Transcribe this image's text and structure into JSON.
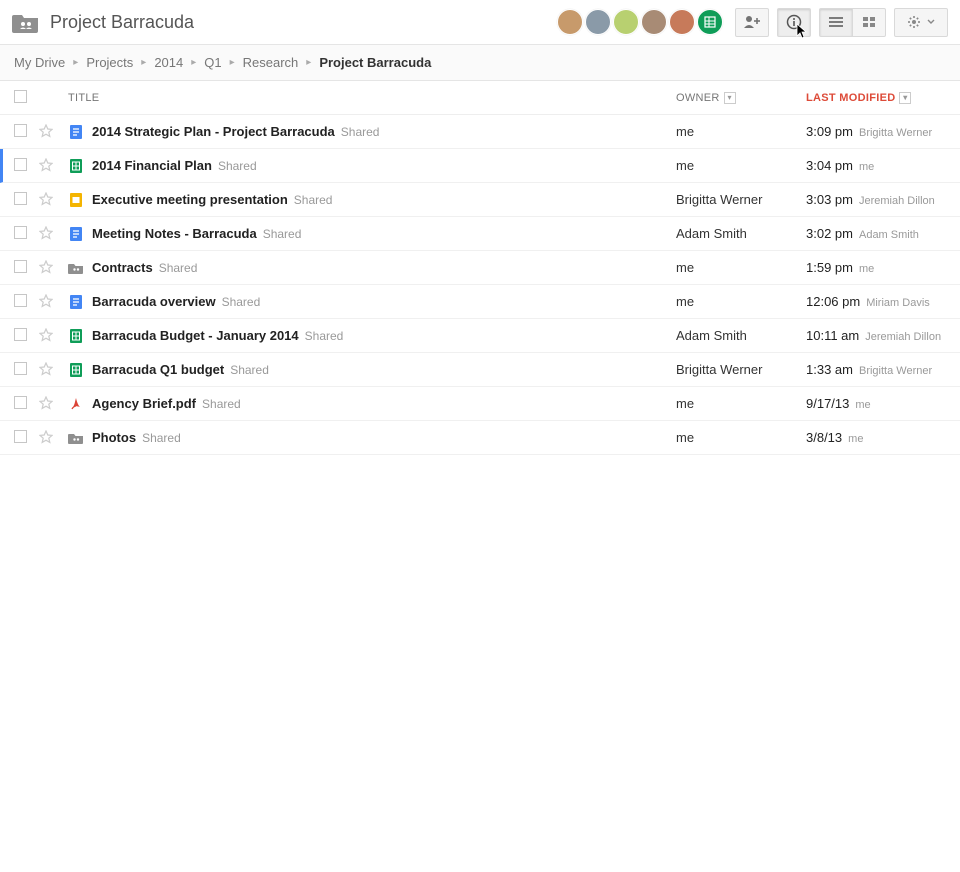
{
  "header": {
    "title": "Project Barracuda"
  },
  "breadcrumbs": [
    {
      "label": "My Drive",
      "current": false
    },
    {
      "label": "Projects",
      "current": false
    },
    {
      "label": "2014",
      "current": false
    },
    {
      "label": "Q1",
      "current": false
    },
    {
      "label": "Research",
      "current": false
    },
    {
      "label": "Project Barracuda",
      "current": true
    }
  ],
  "columns": {
    "title": "TITLE",
    "owner": "OWNER",
    "modified": "LAST MODIFIED"
  },
  "shared_label": "Shared",
  "avatars": [
    "#c79a6b",
    "#8a9aa8",
    "#b8d070",
    "#a88b75",
    "#c77a5a",
    "#0f9d58"
  ],
  "files": [
    {
      "icon": "doc",
      "title": "2014 Strategic Plan - Project Barracuda",
      "shared": true,
      "owner": "me",
      "time": "3:09 pm",
      "by": "Brigitta Werner",
      "selected": false
    },
    {
      "icon": "sheet",
      "title": "2014 Financial Plan",
      "shared": true,
      "owner": "me",
      "time": "3:04 pm",
      "by": "me",
      "selected": true
    },
    {
      "icon": "slides",
      "title": "Executive meeting presentation",
      "shared": true,
      "owner": "Brigitta Werner",
      "time": "3:03 pm",
      "by": "Jeremiah Dillon",
      "selected": false
    },
    {
      "icon": "doc",
      "title": "Meeting Notes - Barracuda",
      "shared": true,
      "owner": "Adam Smith",
      "time": "3:02 pm",
      "by": "Adam Smith",
      "selected": false
    },
    {
      "icon": "folder",
      "title": "Contracts",
      "shared": true,
      "owner": "me",
      "time": "1:59 pm",
      "by": "me",
      "selected": false
    },
    {
      "icon": "doc",
      "title": "Barracuda overview",
      "shared": true,
      "owner": "me",
      "time": "12:06 pm",
      "by": "Miriam Davis",
      "selected": false
    },
    {
      "icon": "sheet",
      "title": "Barracuda Budget - January 2014",
      "shared": true,
      "owner": "Adam Smith",
      "time": "10:11 am",
      "by": "Jeremiah Dillon",
      "selected": false
    },
    {
      "icon": "sheet",
      "title": "Barracuda Q1 budget",
      "shared": true,
      "owner": "Brigitta Werner",
      "time": "1:33 am",
      "by": "Brigitta Werner",
      "selected": false
    },
    {
      "icon": "pdf",
      "title": "Agency Brief.pdf",
      "shared": true,
      "owner": "me",
      "time": "9/17/13",
      "by": "me",
      "selected": false
    },
    {
      "icon": "folder",
      "title": "Photos",
      "shared": true,
      "owner": "me",
      "time": "3/8/13",
      "by": "me",
      "selected": false
    }
  ]
}
